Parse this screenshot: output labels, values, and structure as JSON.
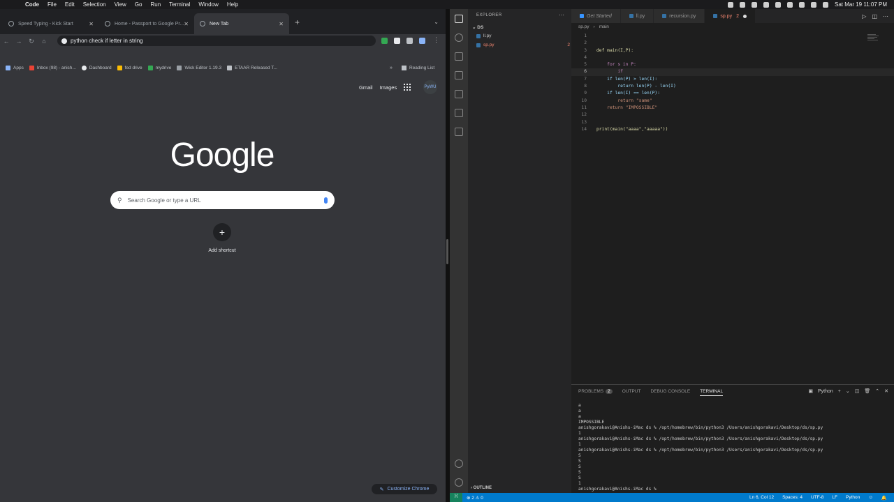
{
  "menubar": {
    "app": "Code",
    "items": [
      "File",
      "Edit",
      "Selection",
      "View",
      "Go",
      "Run",
      "Terminal",
      "Window",
      "Help"
    ],
    "clock": "Sat Mar 19  11:07 PM"
  },
  "chrome": {
    "tabs": [
      {
        "title": "Speed Typing - Kick Start"
      },
      {
        "title": "Home - Passport to Google Pr..."
      },
      {
        "title": "New Tab"
      }
    ],
    "address": "python check if letter in string",
    "bookmarks": [
      {
        "label": "Apps"
      },
      {
        "label": "Inbox (98) - anish..."
      },
      {
        "label": "Dashboard"
      },
      {
        "label": "fed drive"
      },
      {
        "label": "mydrive"
      },
      {
        "label": "Wick Editor 1.19.3"
      },
      {
        "label": "ETAAR Released T..."
      }
    ],
    "bookmarks_more": "»",
    "reading_list": "Reading List",
    "ntp": {
      "gmail": "Gmail",
      "images": "Images",
      "avatar_text": "PyWU",
      "logo": "Google",
      "search_placeholder": "Search Google or type a URL",
      "shortcut_label": "Add shortcut",
      "customize": "Customize Chrome"
    }
  },
  "vscode": {
    "sidebar": {
      "title": "EXPLORER",
      "folder": "DS",
      "files": [
        {
          "name": "ll.py",
          "errors": ""
        },
        {
          "name": "sp.py",
          "errors": "2"
        }
      ],
      "outline": "OUTLINE"
    },
    "tabs": [
      {
        "label": "Get Started"
      },
      {
        "label": "ll.py"
      },
      {
        "label": "recursion.py"
      },
      {
        "label": "sp.py",
        "errors": "2"
      }
    ],
    "breadcrumb": [
      "sp.py",
      "›",
      "main"
    ],
    "code_lines": [
      {
        "n": "1",
        "t": ""
      },
      {
        "n": "2",
        "t": ""
      },
      {
        "n": "3",
        "t": "def main(I,P):"
      },
      {
        "n": "4",
        "t": ""
      },
      {
        "n": "5",
        "t": "    for s in P:"
      },
      {
        "n": "6",
        "t": "        if"
      },
      {
        "n": "7",
        "t": "    if len(P) > len(I):"
      },
      {
        "n": "8",
        "t": "        return len(P) - len(I)"
      },
      {
        "n": "9",
        "t": "    if len(I) == len(P):"
      },
      {
        "n": "10",
        "t": "        return \"same\""
      },
      {
        "n": "11",
        "t": "    return \"IMPOSSIBLE\""
      },
      {
        "n": "12",
        "t": ""
      },
      {
        "n": "13",
        "t": ""
      },
      {
        "n": "14",
        "t": "print(main(\"aaaa\",\"aaaaa\"))"
      }
    ],
    "panel": {
      "tabs": [
        {
          "label": "PROBLEMS",
          "badge": "2"
        },
        {
          "label": "OUTPUT"
        },
        {
          "label": "DEBUG CONSOLE"
        },
        {
          "label": "TERMINAL"
        }
      ],
      "shell": "Python",
      "terminal": "a\na\na\nIMPOSSIBLE\nanishgorakavi@Anishs-iMac ds % /opt/homebrew/bin/python3 /Users/anishgorakavi/Desktop/ds/sp.py\n1\nanishgorakavi@Anishs-iMac ds % /opt/homebrew/bin/python3 /Users/anishgorakavi/Desktop/ds/sp.py\n1\nanishgorakavi@Anishs-iMac ds % /opt/homebrew/bin/python3 /Users/anishgorakavi/Desktop/ds/sp.py\nS\nS\nS\nS\nS\n1\nanishgorakavi@Anishs-iMac ds % "
    },
    "status": {
      "problems": "⊗ 2 ⚠ 0",
      "position": "Ln 6, Col 12",
      "spaces": "Spaces: 4",
      "encoding": "UTF-8",
      "eol": "LF",
      "language": "Python"
    }
  }
}
